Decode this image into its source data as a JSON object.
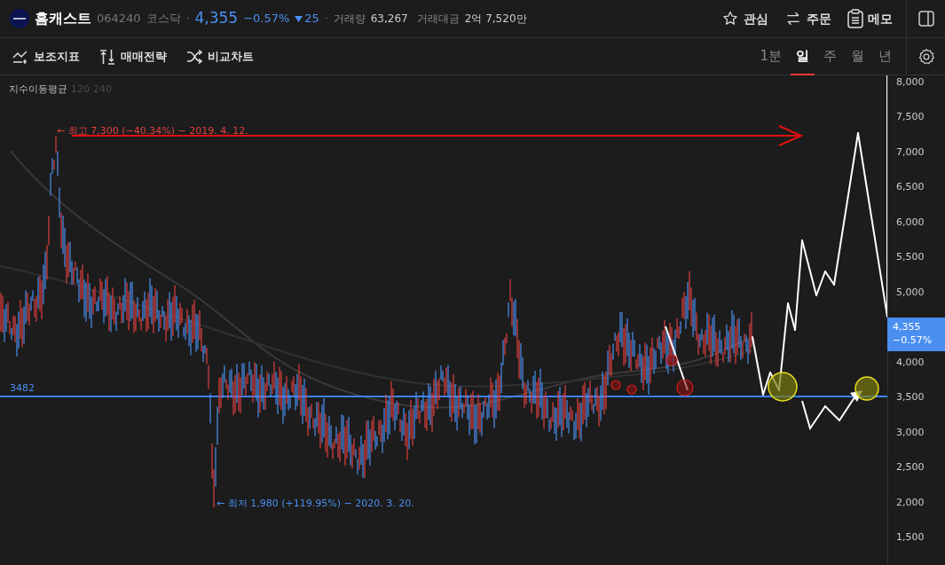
{
  "header": {
    "name": "홈캐스트",
    "code": "064240",
    "market": "코스닥",
    "separators": [
      "·",
      "·"
    ],
    "price": "4,355",
    "change_pct": "−0.57%",
    "change": "25",
    "volume_label": "거래량",
    "volume": "63,267",
    "amount_label": "거래대금",
    "amount": "2억 7,520만",
    "actions": [
      {
        "kind": "star",
        "label": "관심"
      },
      {
        "kind": "swap",
        "label": "주문"
      },
      {
        "kind": "memo",
        "label": "메모"
      }
    ]
  },
  "toolbar": {
    "tools": [
      {
        "kind": "indicator",
        "label": "보조지표"
      },
      {
        "kind": "strategy",
        "label": "매매전략"
      },
      {
        "kind": "compare",
        "label": "비교차트"
      }
    ],
    "periods": [
      {
        "label": "1분",
        "selected": false
      },
      {
        "label": "일",
        "selected": true
      },
      {
        "label": "주",
        "selected": false
      },
      {
        "label": "월",
        "selected": false
      },
      {
        "label": "년",
        "selected": false
      }
    ]
  },
  "chart": {
    "legend": {
      "name": "지수이동평균",
      "periods": [
        "120",
        "240"
      ]
    },
    "high_label": "← 최고 7,300 (−40.34%) − 2019. 4. 12.",
    "low_label": "← 최저 1,980 (+119.95%) − 2020. 3. 20.",
    "line_label": "3482",
    "y_ticks": [
      "8,000",
      "7,500",
      "7,000",
      "6,500",
      "6,000",
      "5,500",
      "5,000",
      "4,000",
      "3,500",
      "3,000",
      "2,500",
      "2,000",
      "1,500"
    ],
    "price_badge": {
      "price": "4,355",
      "change": "−0.57%"
    }
  }
}
